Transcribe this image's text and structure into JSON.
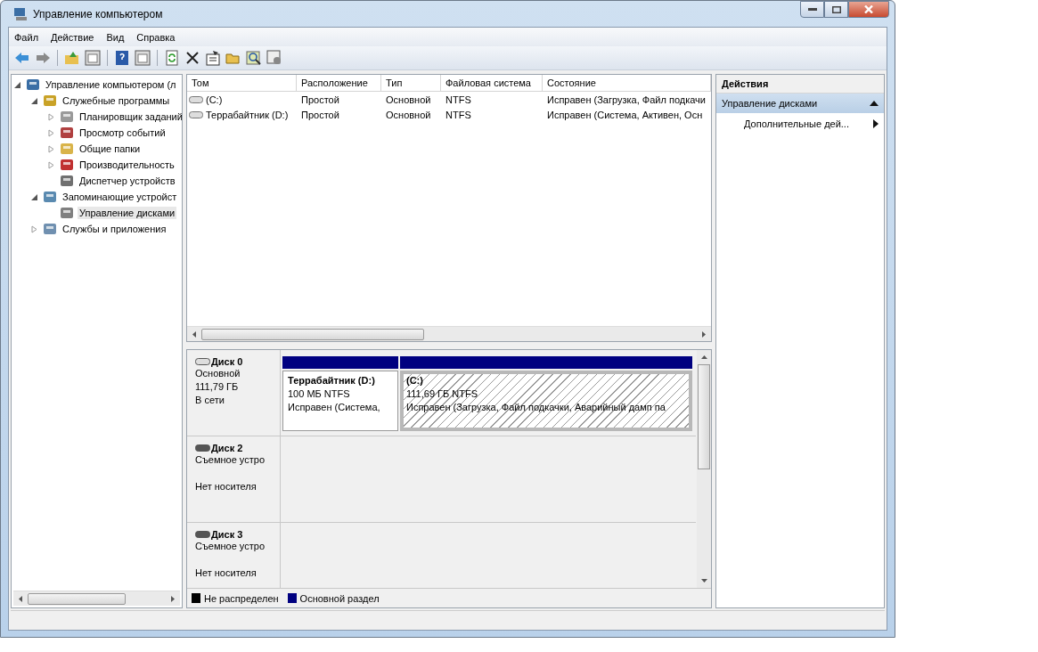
{
  "window": {
    "title": "Управление компьютером"
  },
  "menu": [
    "Файл",
    "Действие",
    "Вид",
    "Справка"
  ],
  "tree": [
    {
      "label": "Управление компьютером (л",
      "expanded": true,
      "selected": false,
      "children": [
        {
          "label": "Служебные программы",
          "expanded": true,
          "selected": false,
          "children": [
            {
              "label": "Планировщик заданий",
              "expanded": false,
              "selected": false
            },
            {
              "label": "Просмотр событий",
              "expanded": false,
              "selected": false
            },
            {
              "label": "Общие папки",
              "expanded": false,
              "selected": false
            },
            {
              "label": "Производительность",
              "expanded": false,
              "selected": false
            },
            {
              "label": "Диспетчер устройств",
              "selected": false
            }
          ]
        },
        {
          "label": "Запоминающие устройст",
          "expanded": true,
          "selected": false,
          "children": [
            {
              "label": "Управление дисками",
              "selected": true
            }
          ]
        },
        {
          "label": "Службы и приложения",
          "expanded": false,
          "selected": false
        }
      ]
    }
  ],
  "table": {
    "columns": [
      "Том",
      "Расположение",
      "Тип",
      "Файловая система",
      "Состояние"
    ],
    "rows": [
      {
        "cells": [
          "(C:)",
          "Простой",
          "Основной",
          "NTFS",
          "Исправен (Загрузка, Файл подкачи"
        ]
      },
      {
        "cells": [
          "Террабайтник (D:)",
          "Простой",
          "Основной",
          "NTFS",
          "Исправен (Система, Активен, Осн"
        ]
      }
    ]
  },
  "disks": [
    {
      "name": "Диск 0",
      "kind": "fixed",
      "type": "Основной",
      "size": "111,79 ГБ",
      "status": "В сети",
      "partitions": [
        {
          "title": "Террабайтник  (D:)",
          "size": "100 МБ NTFS",
          "status": "Исправен (Система,",
          "selected": false
        },
        {
          "title": "(C:)",
          "size": "111,69 ГБ NTFS",
          "status": "Исправен (Загрузка, Файл подкачки, Аварийный дамп па",
          "selected": true
        }
      ]
    },
    {
      "name": "Диск 2",
      "kind": "removable",
      "type": "Съемное устро",
      "status": "Нет носителя"
    },
    {
      "name": "Диск 3",
      "kind": "removable",
      "type": "Съемное устро",
      "status": "Нет носителя"
    }
  ],
  "legend": [
    {
      "label": "Не распределен",
      "color": "#000000"
    },
    {
      "label": "Основной раздел",
      "color": "#000080"
    }
  ],
  "actions": {
    "title": "Действия",
    "section": {
      "label": "Управление дисками",
      "expanded": true
    },
    "items": [
      "Дополнительные дей..."
    ]
  }
}
